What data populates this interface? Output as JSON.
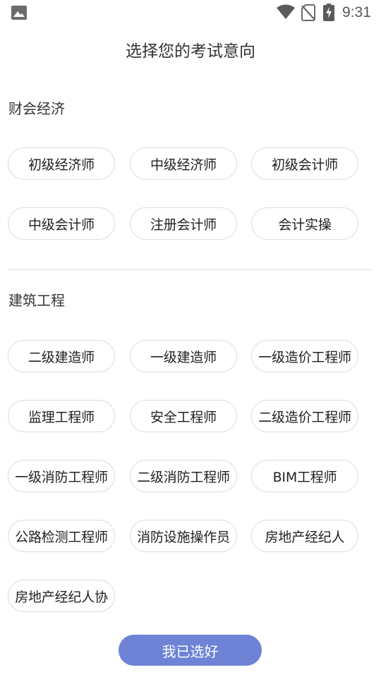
{
  "status_bar": {
    "time": "9:31",
    "icons": [
      "image-icon",
      "wifi-icon",
      "no-sim-icon",
      "battery-charging-icon"
    ]
  },
  "header": {
    "title": "选择您的考试意向"
  },
  "sections": [
    {
      "title": "财会经济",
      "options": [
        "初级经济师",
        "中级经济师",
        "初级会计师",
        "中级会计师",
        "注册会计师",
        "会计实操"
      ]
    },
    {
      "title": "建筑工程",
      "options": [
        "二级建造师",
        "一级建造师",
        "一级造价工程师",
        "监理工程师",
        "安全工程师",
        "二级造价工程师",
        "一级消防工程师",
        "二级消防工程师",
        "BIM工程师",
        "公路检测工程师",
        "消防设施操作员",
        "房地产经纪人",
        "房地产经纪人协"
      ]
    }
  ],
  "footer": {
    "confirm_label": "我已选好"
  },
  "colors": {
    "accent": "#6e82d6",
    "chip_border": "#dddddd",
    "divider": "#e3e3e3"
  }
}
